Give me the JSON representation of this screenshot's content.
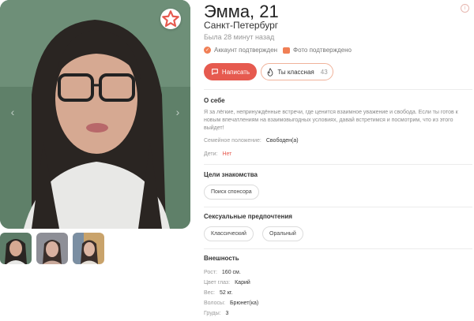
{
  "profile": {
    "name_age": "Эмма, 21",
    "city": "Санкт-Петербург",
    "last_seen": "Была 28 минут назад",
    "account_verified": "Аккаунт подтвержден",
    "photo_verified": "Фото подтверждено",
    "info_icon": "i"
  },
  "actions": {
    "write_label": "Написать",
    "like_label": "Ты классная",
    "like_count": "43"
  },
  "about": {
    "title": "О себе",
    "text": "Я за лёгкие, непринуждённые встречи, где ценится взаимное уважение и свобода. Если ты готов к новым впечатлениям на взаимовыгодных условиях, давай встретимся и посмотрим, что из этого выйдет!",
    "marital_label": "Семейное положение:",
    "marital_value": "Свободен(а)",
    "children_label": "Дети:",
    "children_value": "Нет"
  },
  "goals": {
    "title": "Цели знакомства",
    "tags": [
      "Поиск спонсора"
    ]
  },
  "preferences": {
    "title": "Сексуальные предпочтения",
    "tags": [
      "Классический",
      "Оральный"
    ]
  },
  "appearance": {
    "title": "Внешность",
    "rows": [
      {
        "label": "Рост:",
        "value": "160 см."
      },
      {
        "label": "Цвет глаз:",
        "value": "Карий"
      },
      {
        "label": "Вес:",
        "value": "52 кг."
      },
      {
        "label": "Волосы:",
        "value": "Брюнет(ка)"
      },
      {
        "label": "Груды:",
        "value": "3"
      }
    ]
  },
  "icons": {
    "favorite": "star-icon",
    "write": "chat-bubble-icon",
    "like": "flame-icon",
    "verified": "check-circle-icon",
    "photo": "camera-icon",
    "info": "info-icon"
  },
  "colors": {
    "accent": "#e65a4f",
    "accent_light": "#f07f55",
    "muted_text": "#999999"
  }
}
